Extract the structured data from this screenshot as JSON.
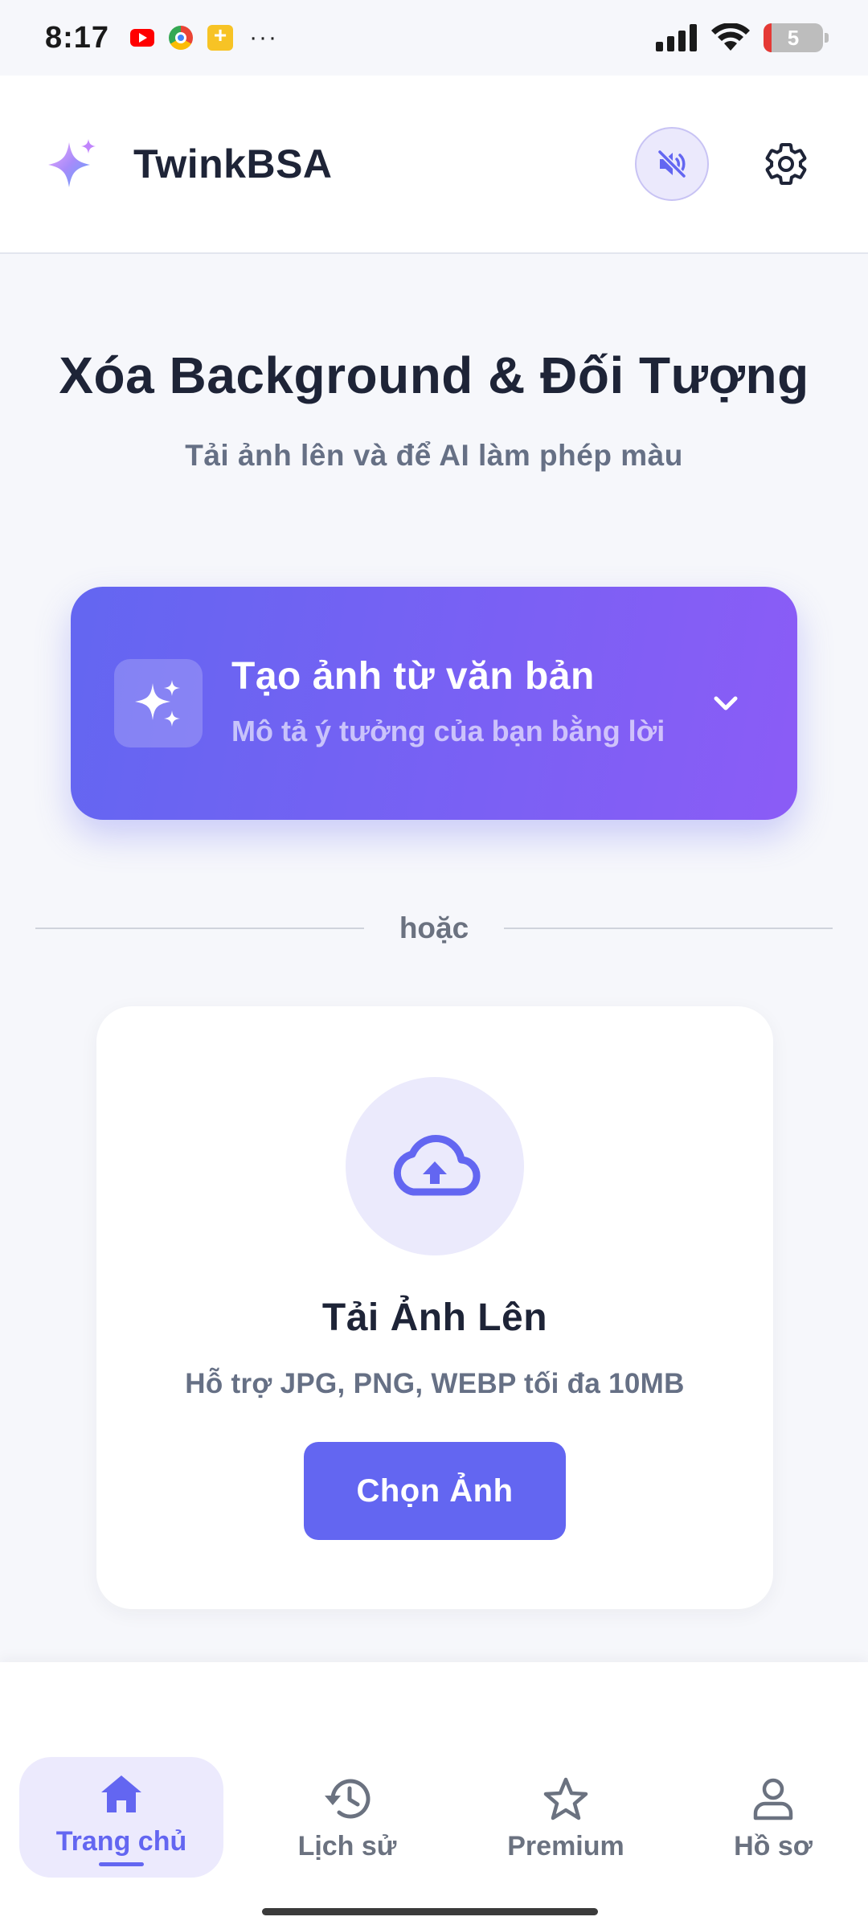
{
  "status_bar": {
    "time": "8:17",
    "battery_level": "5",
    "apps": [
      "youtube-icon",
      "chrome-icon",
      "notes-icon"
    ],
    "more": "···"
  },
  "header": {
    "app_name": "TwinkBSA",
    "logo_icon": "sparkle-logo-icon",
    "mute_icon": "speaker-muted-icon",
    "settings_icon": "gear-icon"
  },
  "hero": {
    "title": "Xóa Background & Đối Tượng",
    "subtitle": "Tải ảnh lên và để AI làm phép màu"
  },
  "text_to_image": {
    "title": "Tạo ảnh từ văn bản",
    "subtitle": "Mô tả ý tưởng của bạn bằng lời",
    "icon": "sparkles-icon",
    "expand_icon": "chevron-down-icon"
  },
  "divider": {
    "label": "hoặc"
  },
  "upload": {
    "icon": "cloud-upload-icon",
    "title": "Tải Ảnh Lên",
    "hint": "Hỗ trợ JPG, PNG, WEBP tối đa 10MB",
    "button_label": "Chọn Ảnh"
  },
  "nav": {
    "items": [
      {
        "label": "Trang chủ",
        "icon": "home-icon",
        "active": true
      },
      {
        "label": "Lịch sử",
        "icon": "history-icon",
        "active": false
      },
      {
        "label": "Premium",
        "icon": "star-icon",
        "active": false
      },
      {
        "label": "Hồ sơ",
        "icon": "person-icon",
        "active": false
      }
    ]
  },
  "colors": {
    "primary": "#6366f1",
    "gradient_end": "#8b5cf6",
    "background": "#f6f7fb",
    "text_dark": "#1e2437",
    "text_muted": "#667085"
  }
}
